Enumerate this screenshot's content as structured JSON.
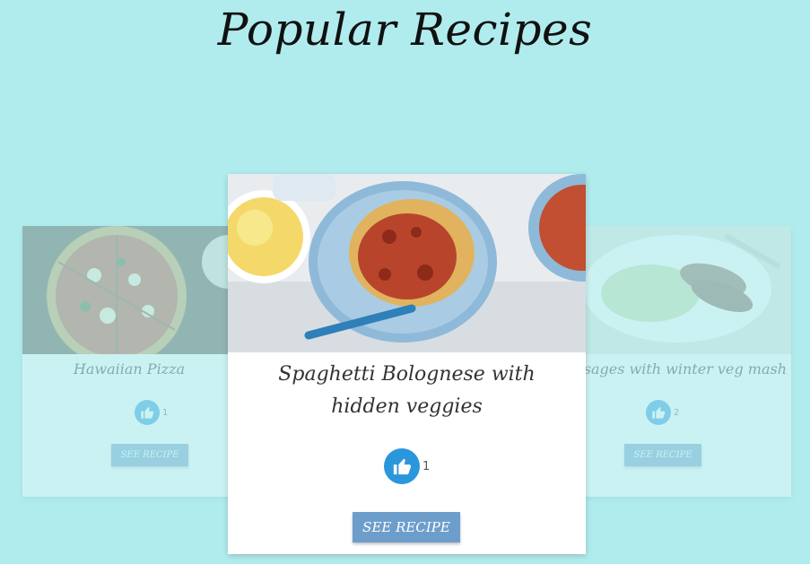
{
  "page": {
    "title": "Popular Recipes"
  },
  "cards": [
    {
      "name": "Hawaiian Pizza",
      "likes": "1",
      "button": "SEE RECIPE"
    },
    {
      "name": "Spaghetti Bolognese with hidden veggies",
      "likes": "1",
      "button": "SEE RECIPE"
    },
    {
      "name": "Sausages with winter veg mash",
      "likes": "2",
      "button": "SEE RECIPE"
    }
  ],
  "icons": {
    "like": "thumbs-up-icon"
  },
  "colors": {
    "background": "#b0ecee",
    "like": "#2a96dc",
    "button": "#6d9ecb"
  }
}
